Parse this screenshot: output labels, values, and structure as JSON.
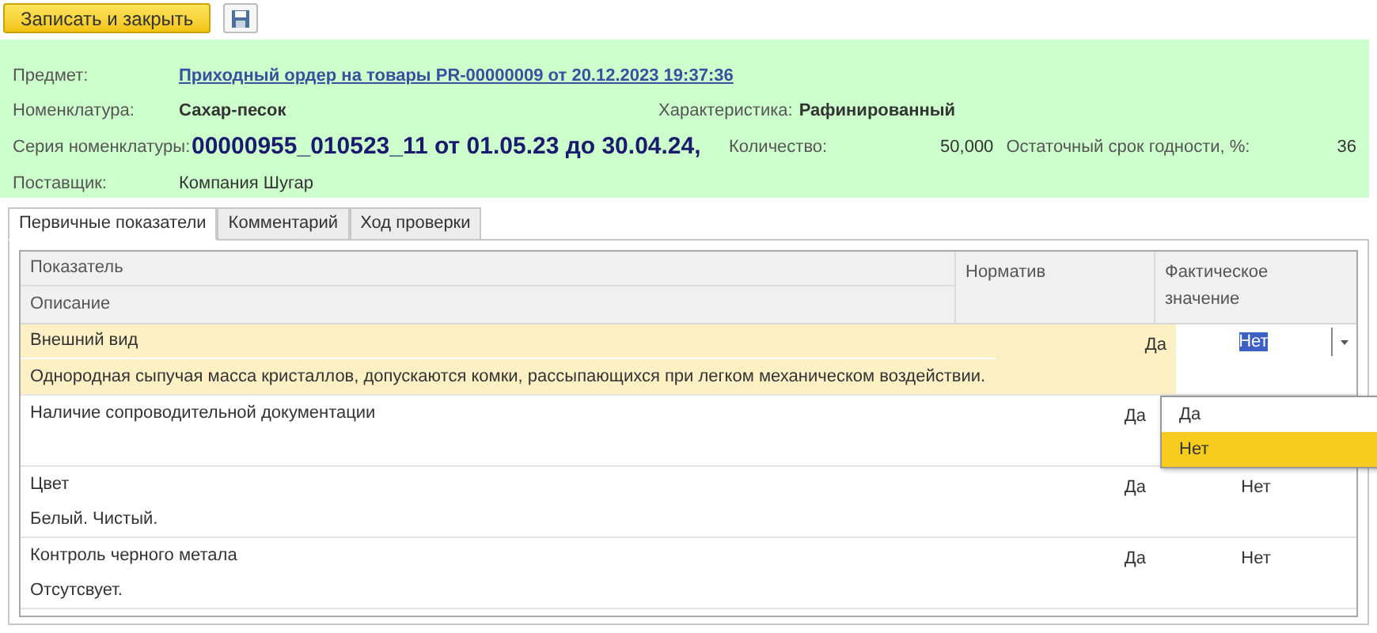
{
  "toolbar": {
    "save_close": "Записать и закрыть"
  },
  "header": {
    "subject": {
      "label": "Предмет:",
      "value": "Приходный ордер на товары PR-00000009 от 20.12.2023 19:37:36"
    },
    "item": {
      "label": "Номенклатура:",
      "value": "Сахар-песок"
    },
    "characteristic": {
      "label": "Характеристика:",
      "value": "Рафинированный"
    },
    "series": {
      "label": "Серия номенклатуры:",
      "value": "00000955_010523_11 от 01.05.23 до 30.04.24,"
    },
    "quantity": {
      "label": "Количество:",
      "value": "50,000"
    },
    "shelf_life": {
      "label": "Остаточный срок годности, %:",
      "value": "36"
    },
    "supplier": {
      "label": "Поставщик:",
      "value": "Компания Шугар"
    }
  },
  "tabs": [
    {
      "label": "Первичные показатели",
      "selected": true
    },
    {
      "label": "Комментарий",
      "selected": false
    },
    {
      "label": "Ход проверки",
      "selected": false
    }
  ],
  "table": {
    "columns": {
      "indicator": "Показатель",
      "description": "Описание",
      "norm": "Норматив",
      "actual": "Фактическое значение"
    },
    "rows": [
      {
        "indicator": "Внешний вид",
        "description": "Однородная сыпучая масса кристаллов, допускаются комки, рассыпающихся при легком механическом воздействии.",
        "norm": "Да",
        "actual": "Нет",
        "selected": true
      },
      {
        "indicator": "Наличие сопроводительной документации",
        "norm": "Да",
        "selected": false
      },
      {
        "indicator": "Цвет",
        "description": "Белый. Чистый.",
        "norm": "Да",
        "actual": "Нет",
        "selected": false
      },
      {
        "indicator": "Контроль черного метала",
        "description": "Отсутсвует.",
        "norm": "Да",
        "actual": "Нет",
        "selected": false
      }
    ]
  },
  "dropdown": {
    "options": [
      {
        "label": "Да",
        "selected": false
      },
      {
        "label": "Нет",
        "selected": true
      }
    ]
  }
}
